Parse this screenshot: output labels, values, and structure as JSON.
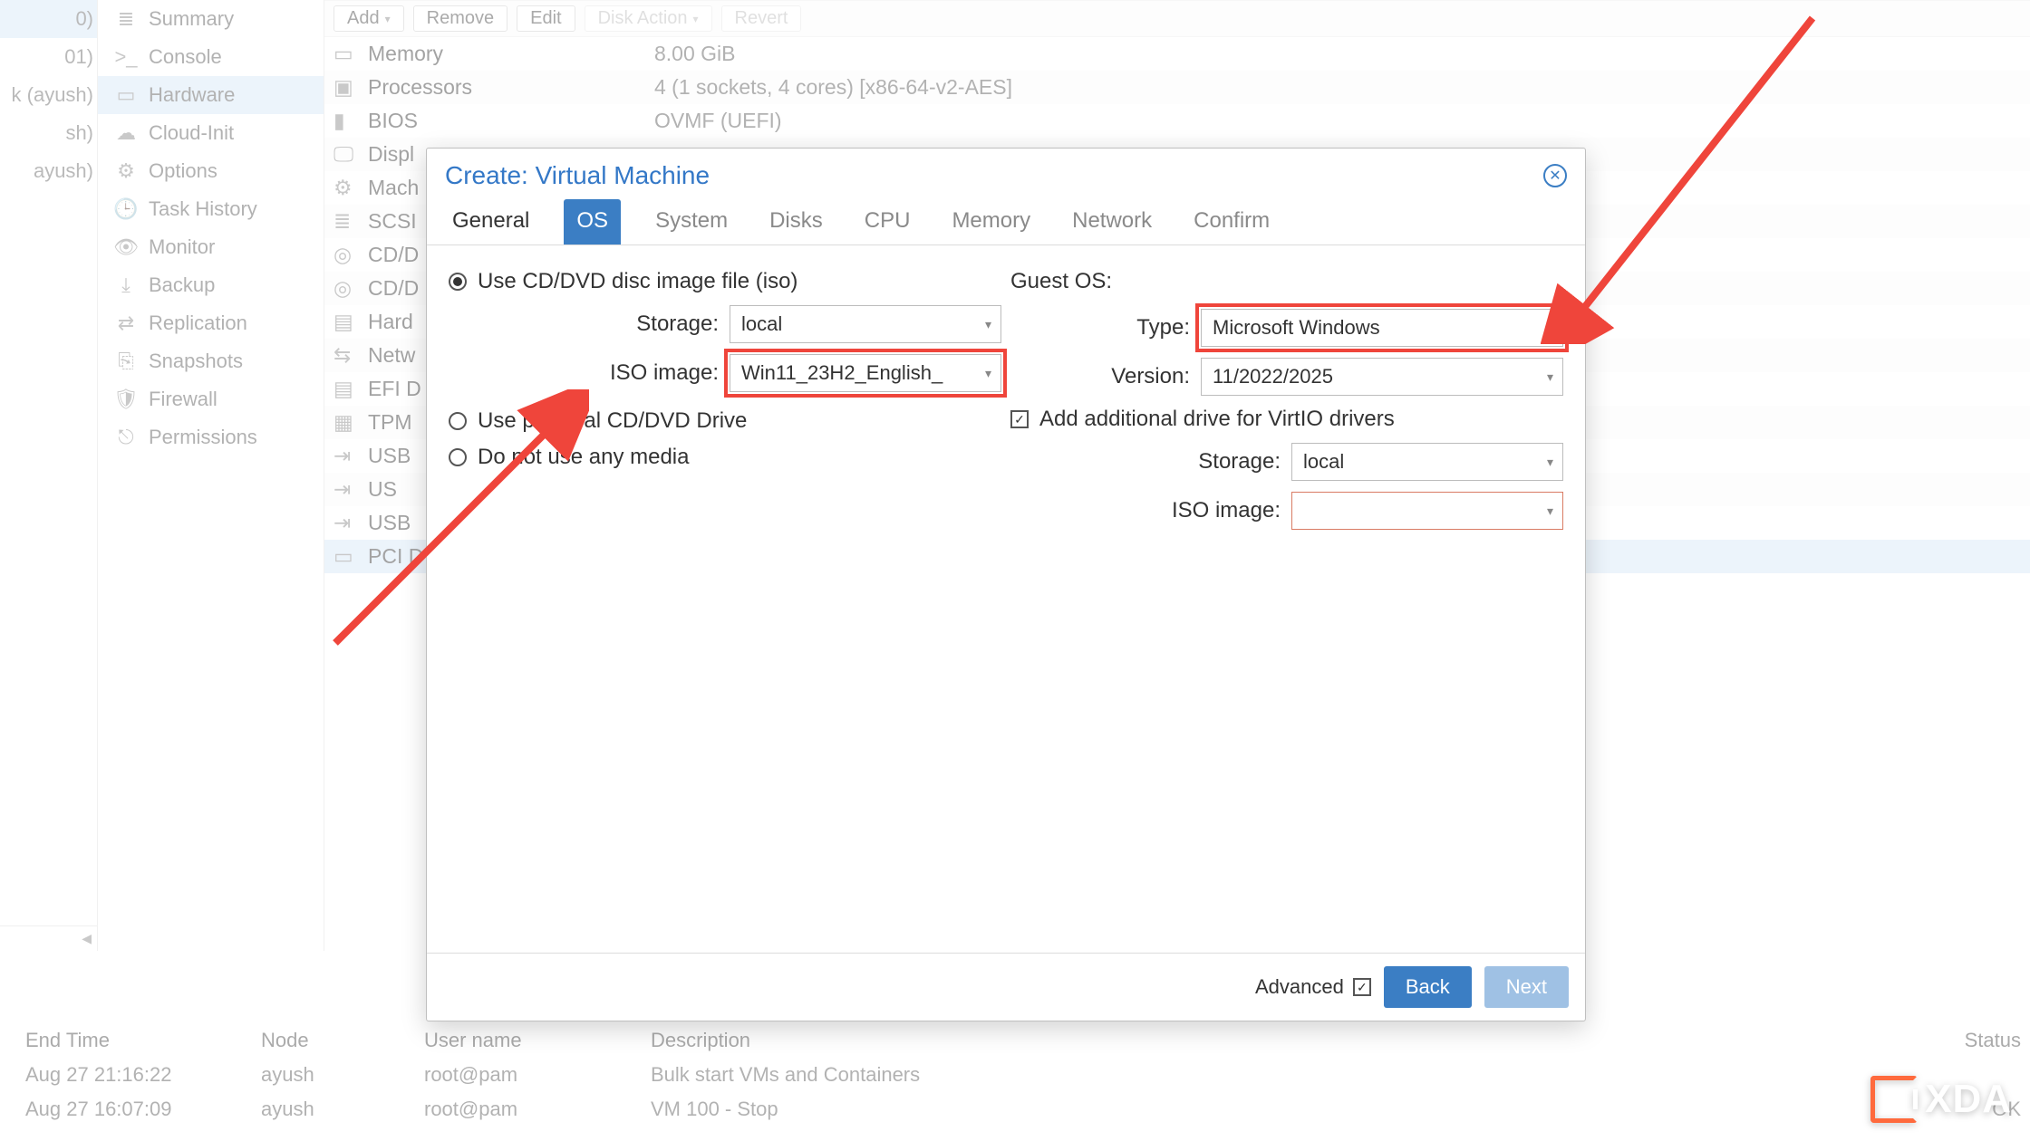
{
  "tree": {
    "items": [
      {
        "label": "0)",
        "selected": true
      },
      {
        "label": "01)"
      },
      {
        "label": "k (ayush)"
      },
      {
        "label": "sh)"
      },
      {
        "label": "ayush)"
      }
    ]
  },
  "nav": {
    "items": [
      {
        "icon": "summary-icon",
        "label": "Summary"
      },
      {
        "icon": "console-icon",
        "label": "Console"
      },
      {
        "icon": "hardware-icon",
        "label": "Hardware",
        "selected": true
      },
      {
        "icon": "cloud-icon",
        "label": "Cloud-Init"
      },
      {
        "icon": "options-icon",
        "label": "Options"
      },
      {
        "icon": "history-icon",
        "label": "Task History"
      },
      {
        "icon": "monitor-icon",
        "label": "Monitor"
      },
      {
        "icon": "backup-icon",
        "label": "Backup"
      },
      {
        "icon": "replication-icon",
        "label": "Replication"
      },
      {
        "icon": "snapshots-icon",
        "label": "Snapshots"
      },
      {
        "icon": "firewall-icon",
        "label": "Firewall"
      },
      {
        "icon": "permissions-icon",
        "label": "Permissions"
      }
    ]
  },
  "toolbar": {
    "add": "Add",
    "remove": "Remove",
    "edit": "Edit",
    "disk_action": "Disk Action",
    "revert": "Revert"
  },
  "hw_rows": [
    {
      "icon": "memory-icon",
      "name": "Memory",
      "value": "8.00 GiB"
    },
    {
      "icon": "cpu-icon",
      "name": "Processors",
      "value": "4 (1 sockets, 4 cores) [x86-64-v2-AES]"
    },
    {
      "icon": "bios-icon",
      "name": "BIOS",
      "value": "OVMF (UEFI)"
    },
    {
      "icon": "display-icon",
      "name": "Displ",
      "value": ""
    },
    {
      "icon": "machine-icon",
      "name": "Mach",
      "value": ""
    },
    {
      "icon": "scsi-icon",
      "name": "SCSI",
      "value": ""
    },
    {
      "icon": "disc-icon",
      "name": "CD/D",
      "value": ""
    },
    {
      "icon": "disc-icon",
      "name": "CD/D",
      "value": ""
    },
    {
      "icon": "hdd-icon",
      "name": "Hard",
      "value": ""
    },
    {
      "icon": "net-icon",
      "name": "Netw",
      "value": ""
    },
    {
      "icon": "hdd-icon",
      "name": "EFI D",
      "value": ""
    },
    {
      "icon": "tpm-icon",
      "name": "TPM",
      "value": ""
    },
    {
      "icon": "usb-icon",
      "name": "USB",
      "value": ""
    },
    {
      "icon": "usb-icon",
      "name": "US",
      "value": ""
    },
    {
      "icon": "usb-icon",
      "name": "USB",
      "value": ""
    },
    {
      "icon": "pci-icon",
      "name": "PCI D",
      "value": "",
      "selected": true
    }
  ],
  "modal": {
    "title": "Create: Virtual Machine",
    "tabs": [
      "General",
      "OS",
      "System",
      "Disks",
      "CPU",
      "Memory",
      "Network",
      "Confirm"
    ],
    "active_tab_index": 1,
    "done_tab_indices": [
      0
    ],
    "left": {
      "opt_iso": "Use CD/DVD disc image file (iso)",
      "opt_phys": "Use physical CD/DVD Drive",
      "opt_none": "Do not use any media",
      "selected": "iso",
      "storage_label": "Storage:",
      "storage_value": "local",
      "iso_label": "ISO image:",
      "iso_value": "Win11_23H2_English_"
    },
    "right": {
      "guest_os": "Guest OS:",
      "type_label": "Type:",
      "type_value": "Microsoft Windows",
      "version_label": "Version:",
      "version_value": "11/2022/2025",
      "virtio_label": "Add additional drive for VirtIO drivers",
      "virtio_checked": true,
      "v_storage_label": "Storage:",
      "v_storage_value": "local",
      "v_iso_label": "ISO image:",
      "v_iso_value": ""
    },
    "footer": {
      "advanced": "Advanced",
      "back": "Back",
      "next": "Next"
    }
  },
  "log": {
    "headers": {
      "end": "End Time",
      "node": "Node",
      "user": "User name",
      "desc": "Description",
      "status": "Status"
    },
    "rows": [
      {
        "end": "Aug 27 21:16:22",
        "node": "ayush",
        "user": "root@pam",
        "desc": "Bulk start VMs and Containers",
        "status": ""
      },
      {
        "end": "Aug 27 16:07:09",
        "node": "ayush",
        "user": "root@pam",
        "desc": "VM 100 - Stop",
        "status": "OK"
      }
    ]
  },
  "icons": {
    "summary-icon": "≣",
    "console-icon": ">_",
    "hardware-icon": "▭",
    "cloud-icon": "☁",
    "options-icon": "⚙",
    "history-icon": "🕒",
    "monitor-icon": "👁",
    "backup-icon": "⤓",
    "replication-icon": "⇄",
    "snapshots-icon": "⎘",
    "firewall-icon": "🛡",
    "permissions-icon": "⎋",
    "memory-icon": "▭",
    "cpu-icon": "▣",
    "bios-icon": "▮",
    "display-icon": "🖵",
    "machine-icon": "⚙",
    "scsi-icon": "≣",
    "disc-icon": "◎",
    "hdd-icon": "▤",
    "net-icon": "⇆",
    "tpm-icon": "▦",
    "usb-icon": "⇥",
    "pci-icon": "▭"
  },
  "watermark": "XDA",
  "accent": "#3b7ec4",
  "highlight": "#ef453b"
}
